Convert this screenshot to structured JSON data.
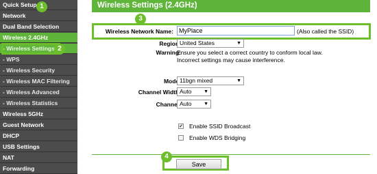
{
  "sidebar": {
    "items": [
      {
        "label": "Quick Setup"
      },
      {
        "label": "Network"
      },
      {
        "label": "Dual Band Selection"
      },
      {
        "label": "Wireless 2.4GHz"
      },
      {
        "label": "- Wireless Settings"
      },
      {
        "label": "- WPS"
      },
      {
        "label": "- Wireless Security"
      },
      {
        "label": "- Wireless MAC Filtering"
      },
      {
        "label": "- Wireless Advanced"
      },
      {
        "label": "- Wireless Statistics"
      },
      {
        "label": "Wireless 5GHz"
      },
      {
        "label": "Guest Network"
      },
      {
        "label": "DHCP"
      },
      {
        "label": "USB Settings"
      },
      {
        "label": "NAT"
      },
      {
        "label": "Forwarding"
      }
    ]
  },
  "main": {
    "title": "Wireless Settings (2.4GHz)",
    "ssid": {
      "label": "Wireless Network Name:",
      "value": "MyPlace",
      "hint": "(Also called the SSID)"
    },
    "region": {
      "label": "Region:",
      "value": "United States"
    },
    "warning": {
      "label": "Warning:",
      "line1": "Ensure you select a correct country to conform local law.",
      "line2": "Incorrect settings may cause interference."
    },
    "mode": {
      "label": "Mode:",
      "value": "11bgn mixed"
    },
    "channel_width": {
      "label": "Channel Width:",
      "value": "Auto"
    },
    "channel": {
      "label": "Channel:",
      "value": "Auto"
    },
    "ssid_broadcast": {
      "label": "Enable SSID Broadcast",
      "checked": true
    },
    "wds": {
      "label": "Enable WDS Bridging",
      "checked": false
    },
    "save_label": "Save"
  },
  "steps": [
    "1",
    "2",
    "3",
    "4"
  ],
  "colors": {
    "accent": "#5fb53a",
    "highlight": "#6cbf2b",
    "sidebar": "#4c4c4c"
  }
}
